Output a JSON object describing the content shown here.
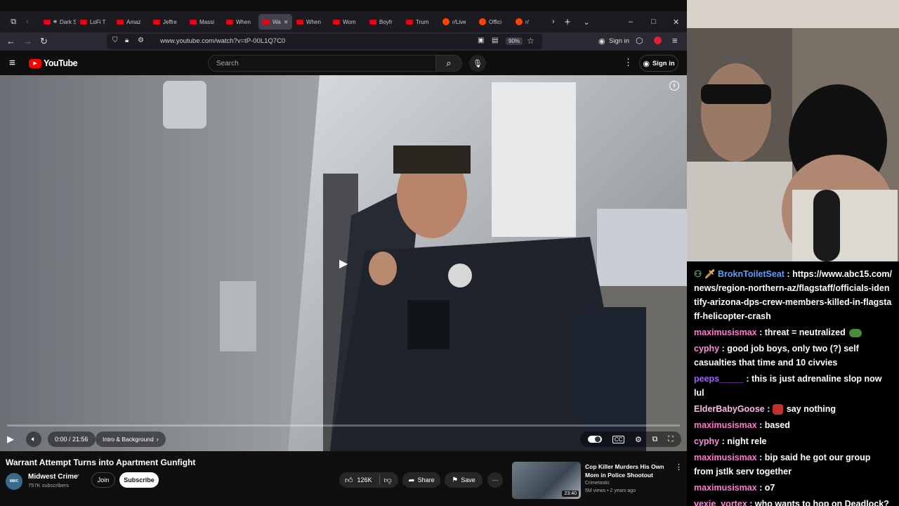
{
  "browser": {
    "tabs": [
      {
        "label": "Dark S",
        "kind": "yt",
        "audio": true
      },
      {
        "label": "LoFi T",
        "kind": "yt"
      },
      {
        "label": "Amaz",
        "kind": "yt"
      },
      {
        "label": "Jeffre",
        "kind": "yt"
      },
      {
        "label": "Massi",
        "kind": "yt"
      },
      {
        "label": "When",
        "kind": "yt"
      },
      {
        "label": "Wa",
        "kind": "yt",
        "active": true
      },
      {
        "label": "When",
        "kind": "yt"
      },
      {
        "label": "Wom",
        "kind": "yt"
      },
      {
        "label": "Boyfr",
        "kind": "yt"
      },
      {
        "label": "Trum",
        "kind": "yt"
      },
      {
        "label": "r/Live",
        "kind": "reddit"
      },
      {
        "label": "Offici",
        "kind": "reddit"
      },
      {
        "label": "r/",
        "kind": "reddit"
      }
    ],
    "url": "www.youtube.com/watch?v=tP-00L1Q7C0",
    "zoom": "90%",
    "sign_in": "Sign in"
  },
  "youtube": {
    "logo": "YouTube",
    "search_placeholder": "Search",
    "sign_in": "Sign in"
  },
  "player": {
    "time": "0:00 / 21:56",
    "chapter": "Intro & Background",
    "progress": 0
  },
  "video": {
    "title": "Warrant Attempt Turns into Apartment Gunfight",
    "channel": "Midwest Crime",
    "subscribers": "757K subscribers",
    "join": "Join",
    "subscribe": "Subscribe",
    "likes": "126K",
    "share": "Share",
    "save": "Save"
  },
  "recommended": {
    "title_line1": "Cop Killer Murders His Own",
    "title_line2": "Mom in Police Shootout",
    "channel": "Crimetastic",
    "meta": "5M views • 2 years ago",
    "duration": "23:40"
  },
  "chat": [
    {
      "user": "BroknToiletSeat",
      "color": "#5aa0ff",
      "badges": true,
      "text": "https://www.abc15.com/news/region-northern-az/flagstaff/officials-identify-arizona-dps-crew-members-killed-in-flagstaff-helicopter-crash"
    },
    {
      "user": "maximusismax",
      "color": "#ff7bd0",
      "text": "threat = neutralized",
      "emote": "frog"
    },
    {
      "user": "cyphy",
      "color": "#ff8ad8",
      "text": "good job boys, only two (?) self casualties that time and 10 civvies"
    },
    {
      "user": "peeps_____",
      "color": "#a35bff",
      "text": "this is just adrenaline slop now lul"
    },
    {
      "user": "ElderBabyGoose",
      "color": "#ffb6e4",
      "text": "say nothing",
      "emote": "red"
    },
    {
      "user": "maximusismax",
      "color": "#ff7bd0",
      "text": "based"
    },
    {
      "user": "cyphy",
      "color": "#ff8ad8",
      "text": "night rele"
    },
    {
      "user": "maximusismax",
      "color": "#ff7bd0",
      "text": "bip said he got our group from jstlk serv together"
    },
    {
      "user": "maximusismax",
      "color": "#ff7bd0",
      "text": "o7"
    },
    {
      "user": "vexie_vortex",
      "color": "#ff8ad8",
      "text": "who wants to hop on Deadlock?"
    }
  ]
}
